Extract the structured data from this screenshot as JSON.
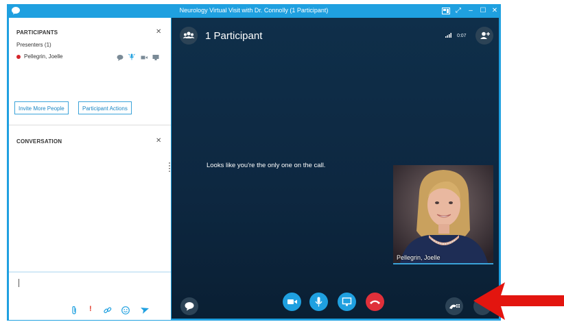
{
  "window": {
    "title": "Neurology Virtual Visit with Dr. Connolly (1 Participant)"
  },
  "participants_panel": {
    "heading": "PARTICIPANTS",
    "presenters_label": "Presenters (1)",
    "participant_name": "Pellegrin, Joelle",
    "invite_button": "Invite More People",
    "actions_button": "Participant Actions"
  },
  "conversation_panel": {
    "heading": "CONVERSATION"
  },
  "main": {
    "participant_count": "1 Participant",
    "call_time": "0:07",
    "alone_message": "Looks like you're the only one on the call.",
    "self_video_name": "Pellegrin, Joelle"
  },
  "colors": {
    "accent": "#1fa0e0",
    "call_bg": "#0f2f4a",
    "hangup": "#e0303a",
    "arrow": "#e3150f",
    "presence_dot": "#d4252b"
  }
}
